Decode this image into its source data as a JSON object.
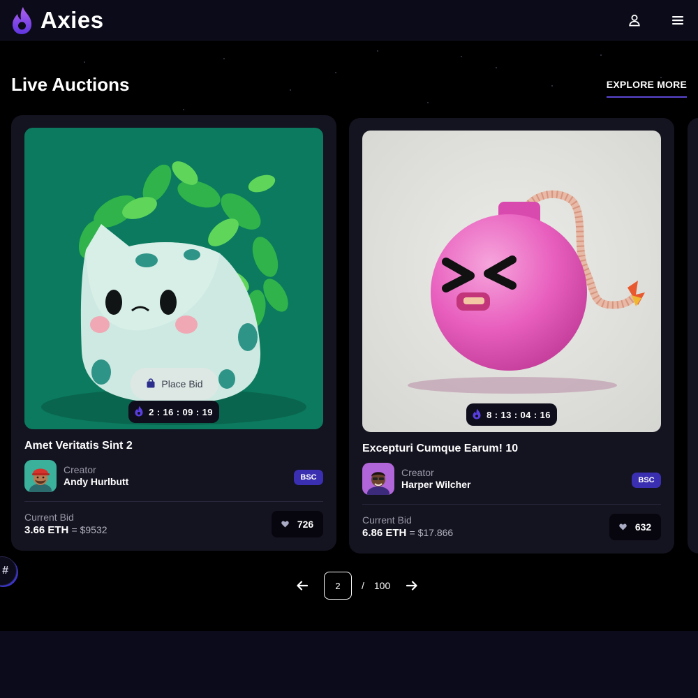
{
  "header": {
    "brand": "Axies",
    "icons": [
      "flame-logo-icon",
      "user-icon",
      "menu-icon"
    ]
  },
  "section": {
    "title": "Live Auctions",
    "explore_label": "EXPLORE MORE"
  },
  "cards": [
    {
      "art": "green-plant-creature",
      "place_bid_label": "Place Bid",
      "timer": "2 : 16 : 09 : 19",
      "title": "Amet Veritatis Sint 2",
      "creator_label": "Creator",
      "creator_name": "Andy Hurlbutt",
      "chain": "BSC",
      "bid_label": "Current Bid",
      "bid_eth": "3.66 ETH",
      "bid_usd": "= $9532",
      "likes": "726"
    },
    {
      "art": "pink-bomb-character",
      "timer": "8 : 13 : 04 : 16",
      "title": "Excepturi Cumque Earum! 10",
      "creator_label": "Creator",
      "creator_name": "Harper Wilcher",
      "chain": "BSC",
      "bid_label": "Current Bid",
      "bid_eth": "6.86 ETH",
      "bid_usd": "= $17.866",
      "likes": "632"
    }
  ],
  "pagination": {
    "current": "2",
    "separator": "/",
    "total": "100"
  },
  "floating_badge": "#",
  "colors": {
    "background": "#000000",
    "header": "#0c0b19",
    "card": "#141320",
    "accent": "#5b47d6",
    "badge": "#3a2fb0"
  }
}
